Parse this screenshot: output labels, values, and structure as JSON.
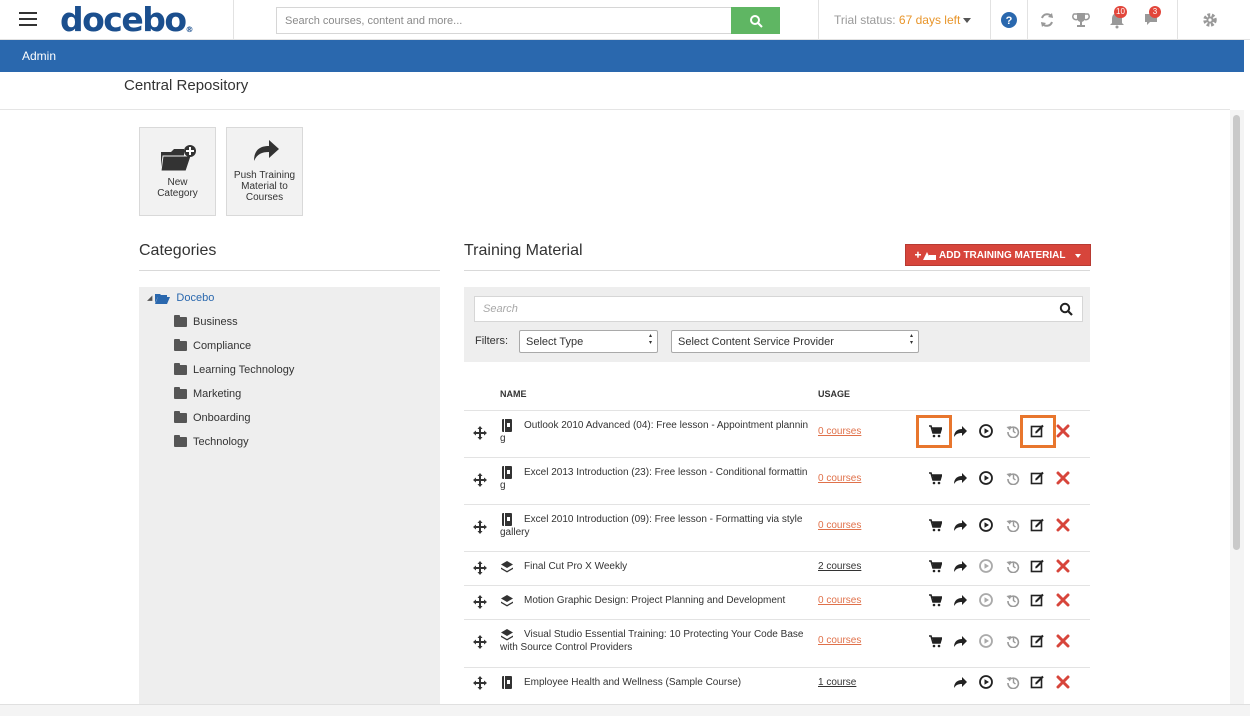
{
  "header": {
    "logo_text": "docebo",
    "logo_mark": "®",
    "search_placeholder": "Search courses, content and more...",
    "trial_label": "Trial status:",
    "trial_days": "67 days left",
    "notifications_count": "10",
    "messages_count": "3",
    "icons": [
      "menu-icon",
      "search-icon",
      "help-icon",
      "sync-icon",
      "trophy-icon",
      "bell-icon",
      "chat-icon",
      "gear-icon"
    ]
  },
  "adminbar": {
    "label": "Admin"
  },
  "page": {
    "title": "Central Repository"
  },
  "tiles": [
    {
      "label": "New Category",
      "icon": "folder-plus-icon"
    },
    {
      "label": "Push Training Material to Courses",
      "icon": "share-arrow-icon"
    }
  ],
  "categories": {
    "title": "Categories",
    "root": "Docebo",
    "items": [
      "Business",
      "Compliance",
      "Learning Technology",
      "Marketing",
      "Onboarding",
      "Technology"
    ]
  },
  "training": {
    "title": "Training Material",
    "add_button": "ADD TRAINING MATERIAL",
    "search_placeholder": "Search",
    "filters_label": "Filters:",
    "select_type": "Select Type",
    "select_provider": "Select Content Service Provider",
    "col_name": "NAME",
    "col_usage": "USAGE",
    "rows": [
      {
        "name": "Outlook 2010 Advanced (04): Free lesson - Appointment planning",
        "usage": "0 courses",
        "type": "book-icon"
      },
      {
        "name": "Excel 2013 Introduction (23): Free lesson - Conditional formatting",
        "usage": "0 courses",
        "type": "book-icon"
      },
      {
        "name": "Excel 2010 Introduction (09): Free lesson - Formatting via style gallery",
        "usage": "0 courses",
        "type": "book-icon"
      },
      {
        "name": "Final Cut Pro X Weekly",
        "usage": "2 courses",
        "type": "layers-icon"
      },
      {
        "name": "Motion Graphic Design: Project Planning and Development",
        "usage": "0 courses",
        "type": "layers-icon"
      },
      {
        "name": "Visual Studio Essential Training: 10 Protecting Your Code Base with Source Control Providers",
        "usage": "0 courses",
        "type": "layers-icon"
      },
      {
        "name": "Employee Health and Wellness (Sample Course)",
        "usage": "1 course",
        "type": "book-icon"
      }
    ]
  },
  "colors": {
    "brand_blue": "#1b4f8e",
    "admin_bar": "#2a68ae",
    "search_green": "#5fb663",
    "add_button_red": "#d7453b",
    "usage_link_orange": "#e0714a",
    "highlight_orange": "#e8762d",
    "delete_red": "#d7453b"
  }
}
